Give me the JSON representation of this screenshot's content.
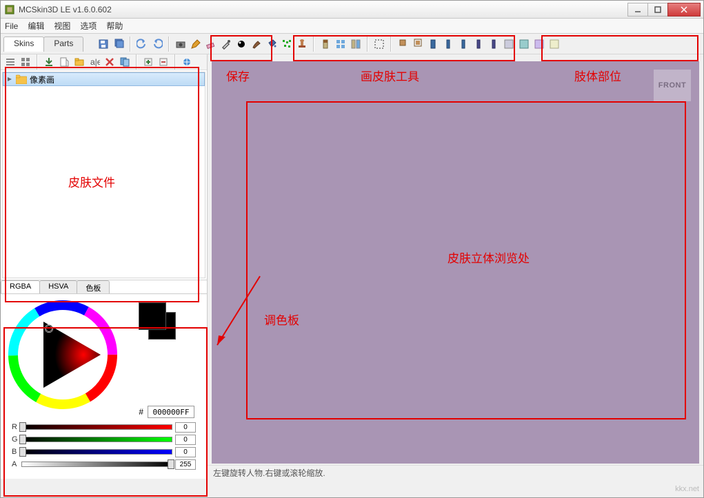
{
  "window": {
    "title": "MCSkin3D LE v1.6.0.602"
  },
  "menu": {
    "file": "File",
    "edit": "编辑",
    "view": "视图",
    "options": "选项",
    "help": "帮助"
  },
  "tabs": {
    "skins": "Skins",
    "parts": "Parts"
  },
  "tree": {
    "item1": "像素画"
  },
  "color_tabs": {
    "rgba": "RGBA",
    "hsva": "HSVA",
    "palette": "色板"
  },
  "hex": {
    "label": "#",
    "value": "000000FF"
  },
  "sliders": {
    "r": {
      "label": "R",
      "value": "0"
    },
    "g": {
      "label": "G",
      "value": "0"
    },
    "b": {
      "label": "B",
      "value": "0"
    },
    "a": {
      "label": "A",
      "value": "255"
    }
  },
  "viewer": {
    "front_badge": "FRONT",
    "status": "左键旋转人物.右键或滚轮缩放."
  },
  "annotations": {
    "save": "保存",
    "tools": "画皮肤工具",
    "parts": "肢体部位",
    "files": "皮肤文件",
    "palette": "调色板",
    "preview": "皮肤立体浏览处"
  },
  "icon_colors": {
    "save": "#5b86c8",
    "camera": "#555",
    "pencil": "#e0a030",
    "undo": "#5c8fd6",
    "redo": "#5c8fd6",
    "x": "#d04040",
    "dropper": "#555",
    "eraser": "#c06080",
    "noise": "#228b22",
    "bucket": "#4a6aa5",
    "stamp": "#a05030",
    "brush": "#8a5a3a"
  },
  "watermark": "kkx.net"
}
